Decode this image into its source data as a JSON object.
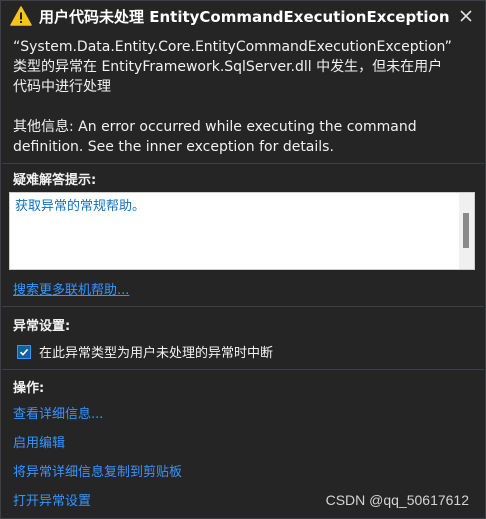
{
  "dialog": {
    "title": "用户代码未处理 EntityCommandExecutionException",
    "close_icon": "close-icon",
    "warning_icon": "warning-icon",
    "warning_color": "#f5c518"
  },
  "message": {
    "line1": "“System.Data.Entity.Core.EntityCommandExecutionException”",
    "line2": "类型的异常在 EntityFramework.SqlServer.dll 中发生，但未在用户",
    "line3": "代码中进行处理"
  },
  "extra_info": {
    "line1": "其他信息: An error occurred while executing the command",
    "line2": "definition. See the inner exception for details."
  },
  "troubleshooting": {
    "label": "疑难解答提示:",
    "tip_link": "获取异常的常规帮助。",
    "more_help_link": "搜索更多联机帮助..."
  },
  "exception_settings": {
    "label": "异常设置:",
    "checkbox_label": "在此异常类型为用户未处理的异常时中断",
    "checked": true
  },
  "actions": {
    "label": "操作:",
    "items": [
      "查看详细信息...",
      "启用编辑",
      "将异常详细信息复制到剪贴板",
      "打开异常设置"
    ]
  },
  "watermark": "CSDN @qq_50617612",
  "colors": {
    "background": "#252526",
    "link": "#3794ff",
    "divider": "#3f3f46",
    "checkbox": "#0e639c"
  }
}
